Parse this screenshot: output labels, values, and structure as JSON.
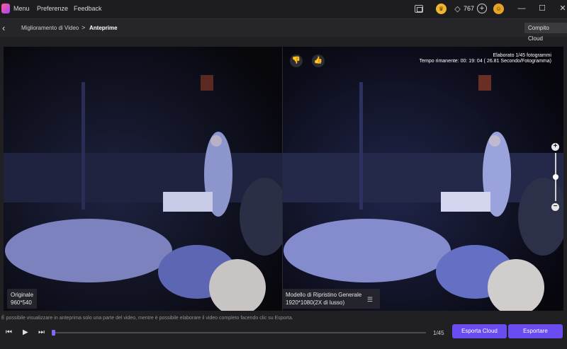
{
  "menubar": {
    "items": [
      "Menu",
      "Preferenze",
      "Feedback"
    ],
    "credits": "767"
  },
  "breadcrumb": {
    "parent": "Miglioramento di Video",
    "separator": ">",
    "current": "Anteprime"
  },
  "cloud_task_label": "Compito Cloud",
  "preview": {
    "progress_line1": "Elaborato 1/45 fotogrammi",
    "progress_line2": "Tempo rimanente: 00: 19: 04 ( 26.81 Secondo/Fotogramma)",
    "original_label": "Originale",
    "original_resolution": "960*540",
    "model_label": "Modello di Ripristino Generale",
    "model_resolution": "1920*1080(2X di lusso)",
    "zoom_level": 0.5
  },
  "notice": "È possibile visualizzare in anteprima solo una parte del video, mentre è possibile elaborare il video completo facendo clic su Esporta.",
  "player": {
    "frame_counter": "1/45",
    "progress": 0.0
  },
  "buttons": {
    "cloud_export": "Esporta Cloud",
    "export": "Esportare"
  },
  "colors": {
    "accent": "#6a4cf0",
    "background": "#202023"
  }
}
